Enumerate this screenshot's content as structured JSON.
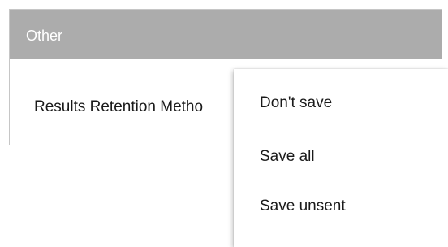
{
  "panel": {
    "title": "Other",
    "field_label": "Results Retention Metho"
  },
  "dropdown": {
    "options": [
      {
        "label": "Don't save"
      },
      {
        "label": "Save all"
      },
      {
        "label": "Save unsent"
      }
    ]
  },
  "colors": {
    "header_bg": "#acacac",
    "header_text": "#ffffff",
    "text": "#1a1a1a",
    "border": "#c6c6c6"
  }
}
